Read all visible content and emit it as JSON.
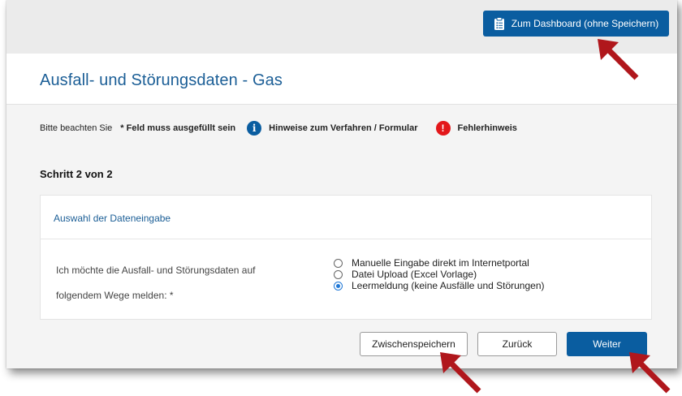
{
  "header": {
    "dashboard_button": "Zum Dashboard (ohne Speichern)"
  },
  "page": {
    "title": "Ausfall- und Störungsdaten - Gas"
  },
  "notes": {
    "intro": "Bitte beachten Sie",
    "required": "* Feld muss ausgefüllt sein",
    "info_symbol": "i",
    "info_text": "Hinweise zum Verfahren / Formular",
    "error_symbol": "!",
    "error_text": "Fehlerhinweis"
  },
  "step": "Schritt 2 von 2",
  "card": {
    "title": "Auswahl der Dateneingabe",
    "question_line1": "Ich möchte die Ausfall- und Störungsdaten auf",
    "question_line2": "folgendem Wege melden: *",
    "options": [
      {
        "label": "Manuelle Eingabe direkt im Internetportal",
        "selected": false
      },
      {
        "label": "Datei Upload (Excel Vorlage)",
        "selected": false
      },
      {
        "label": "Leermeldung (keine Ausfälle und Störungen)",
        "selected": true
      }
    ]
  },
  "buttons": {
    "save": "Zwischenspeichern",
    "back": "Zurück",
    "next": "Weiter"
  },
  "colors": {
    "primary": "#0a5da0",
    "title": "#1b5e96",
    "error": "#e3171a",
    "arrow": "#b0171c"
  },
  "icons": {
    "dashboard": "clipboard-icon",
    "info": "info-icon",
    "error": "error-icon",
    "annotation": "arrow-icon"
  }
}
